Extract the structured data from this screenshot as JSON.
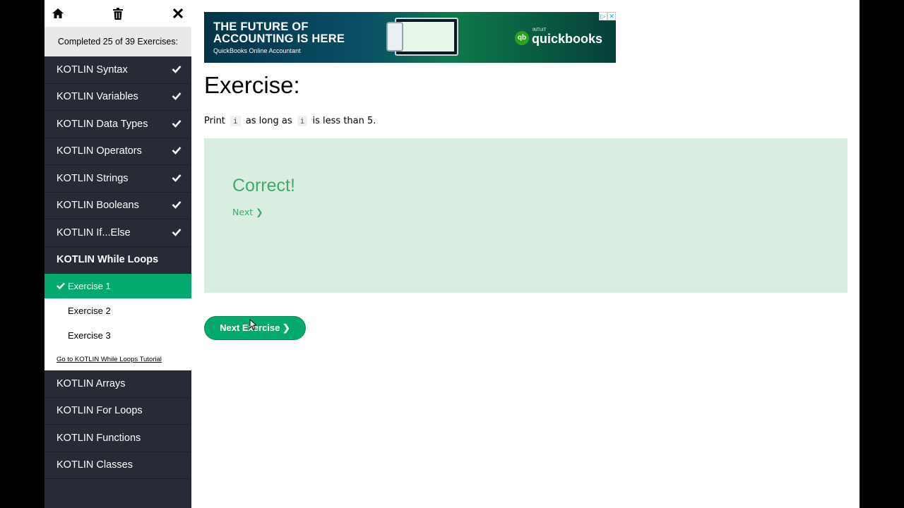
{
  "sidebar": {
    "progress_text": "Completed 25 of 39 Exercises:",
    "items_before": [
      {
        "label": "KOTLIN Syntax"
      },
      {
        "label": "KOTLIN Variables"
      },
      {
        "label": "KOTLIN Data Types"
      },
      {
        "label": "KOTLIN Operators"
      },
      {
        "label": "KOTLIN Strings"
      },
      {
        "label": "KOTLIN Booleans"
      },
      {
        "label": "KOTLIN If...Else"
      }
    ],
    "active_section": "KOTLIN While Loops",
    "exercises": [
      "Exercise 1",
      "Exercise 2",
      "Exercise 3"
    ],
    "tutorial_link": "Go to KOTLIN While Loops Tutorial",
    "items_after": [
      {
        "label": "KOTLIN Arrays"
      },
      {
        "label": "KOTLIN For Loops"
      },
      {
        "label": "KOTLIN Functions"
      },
      {
        "label": "KOTLIN Classes"
      }
    ]
  },
  "ad": {
    "headline_1": "THE FUTURE OF",
    "headline_2": "ACCOUNTING IS HERE",
    "subtitle": "QuickBooks Online Accountant",
    "brand_small": "INTUIT",
    "brand": "quickbooks",
    "brand_badge": "qb"
  },
  "main": {
    "title": "Exercise:",
    "instruction_1": "Print",
    "code_1": "i",
    "instruction_2": "as long as",
    "code_2": "i",
    "instruction_3": "is less than 5.",
    "result_text": "Correct!",
    "next_link": "Next ❯",
    "next_button": "Next Exercise ❯"
  },
  "colors": {
    "accent": "#04aa6d",
    "sidebar_bg": "#282a35",
    "result_bg": "#d9eee1"
  }
}
